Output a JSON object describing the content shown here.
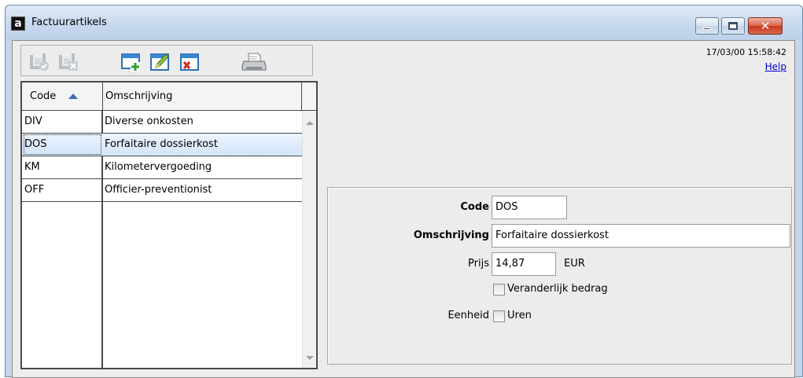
{
  "window": {
    "title": "Factuurartikels",
    "app_icon_glyph": "a",
    "close_glyph": "✕"
  },
  "toolbar": {
    "icons": [
      "save-check-icon",
      "save-cancel-icon",
      "new-record-icon",
      "edit-record-icon",
      "delete-record-icon",
      "print-icon"
    ],
    "datetime": "17/03/00 15:58:42",
    "help_label": "Help"
  },
  "list": {
    "headers": {
      "code": "Code",
      "description": "Omschrijving"
    },
    "rows": [
      {
        "code": "DIV",
        "description": "Diverse onkosten"
      },
      {
        "code": "DOS",
        "description": "Forfaitaire dossierkost"
      },
      {
        "code": "KM",
        "description": "Kilometervergoeding"
      },
      {
        "code": "OFF",
        "description": "Officier-preventionist"
      }
    ],
    "selected_index": 1
  },
  "detail": {
    "code_label": "Code",
    "code_value": "DOS",
    "description_label": "Omschrijving",
    "description_value": "Forfaitaire dossierkost",
    "price_label": "Prijs",
    "price_value": "14,87",
    "currency": "EUR",
    "variable_amount_label": "Veranderlijk bedrag",
    "unit_label": "Eenheid",
    "hours_label": "Uren"
  },
  "colors": {
    "accent": "#3b6fb6",
    "selection": "#d3e5fa",
    "window_frame": "#c5d6ea",
    "close_button": "#c7371d"
  }
}
